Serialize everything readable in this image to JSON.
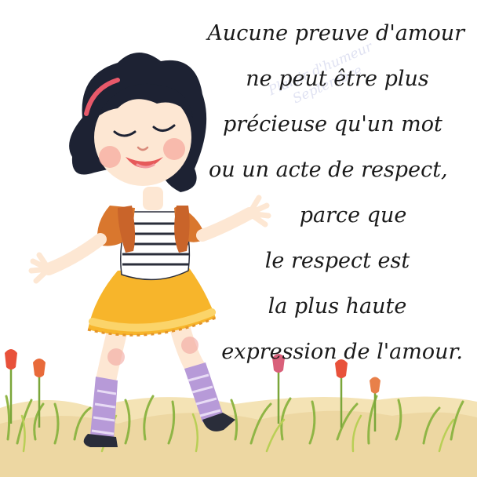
{
  "quote": {
    "lines": [
      "Aucune preuve d'amour",
      "ne peut être plus",
      "précieuse qu'un mot",
      "ou un acte de respect,",
      "parce que",
      "le respect est",
      "la plus haute",
      "expression de l'amour."
    ]
  },
  "watermark": {
    "lines": [
      "Plaisir d'humeur",
      "Septembre"
    ]
  },
  "colors": {
    "background": "#ffffff",
    "text": "#1a1a1a",
    "hair": "#1d2233",
    "skin": "#fde7d3",
    "jacket": "#d9772e",
    "skirt": "#f7b52b",
    "socks": "#b79ad8",
    "grass": "#8fb545",
    "tulip": "#e8513a"
  }
}
